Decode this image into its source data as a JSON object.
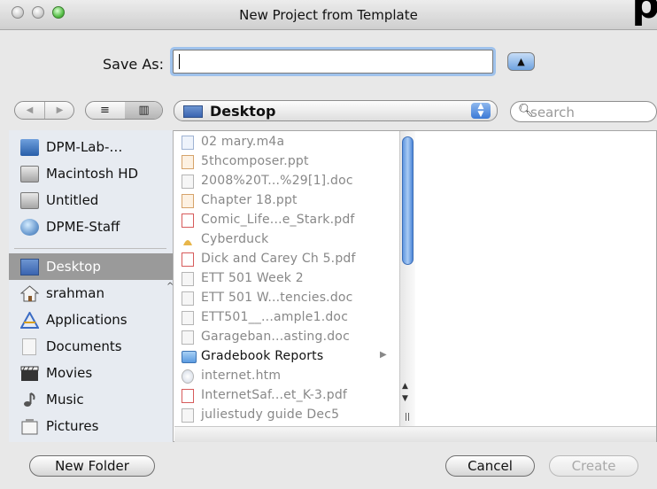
{
  "window": {
    "title": "New Project from Template",
    "corner_mark": "p"
  },
  "save_as": {
    "label": "Save As:",
    "value": ""
  },
  "toolbar": {
    "back_glyph": "◀",
    "forward_glyph": "▶",
    "list_view_glyph": "≡",
    "column_view_glyph": "▥",
    "location": "Desktop",
    "search_placeholder": "search"
  },
  "sidebar": {
    "devices": [
      {
        "label": "DPM-Lab-…",
        "icon": "network-icon"
      },
      {
        "label": "Macintosh HD",
        "icon": "hard-drive-icon"
      },
      {
        "label": "Untitled",
        "icon": "disk-icon"
      },
      {
        "label": "DPME-Staff",
        "icon": "server-icon"
      }
    ],
    "places": [
      {
        "label": "Desktop",
        "icon": "desktop-icon",
        "selected": true
      },
      {
        "label": "srahman",
        "icon": "home-icon"
      },
      {
        "label": "Applications",
        "icon": "applications-icon"
      },
      {
        "label": "Documents",
        "icon": "documents-icon"
      },
      {
        "label": "Movies",
        "icon": "movies-icon"
      },
      {
        "label": "Music",
        "icon": "music-icon"
      },
      {
        "label": "Pictures",
        "icon": "pictures-icon"
      }
    ]
  },
  "files": [
    {
      "label": "02 mary.m4a",
      "icon": "audio-file-icon",
      "enabled": false
    },
    {
      "label": "5thcomposer.ppt",
      "icon": "ppt-file-icon",
      "enabled": false
    },
    {
      "label": "2008%20T...%29[1].doc",
      "icon": "doc-file-icon",
      "enabled": false
    },
    {
      "label": "Chapter 18.ppt",
      "icon": "ppt-file-icon",
      "enabled": false
    },
    {
      "label": "Comic_Life...e_Stark.pdf",
      "icon": "pdf-file-icon",
      "enabled": false
    },
    {
      "label": "Cyberduck",
      "icon": "app-icon",
      "enabled": false
    },
    {
      "label": "Dick and Carey Ch 5.pdf",
      "icon": "pdf-file-icon",
      "enabled": false
    },
    {
      "label": "ETT 501 Week 2",
      "icon": "doc-file-icon",
      "enabled": false
    },
    {
      "label": "ETT 501 W...tencies.doc",
      "icon": "doc-file-icon",
      "enabled": false
    },
    {
      "label": "ETT501__...ample1.doc",
      "icon": "doc-file-icon",
      "enabled": false
    },
    {
      "label": "Garageban...asting.doc",
      "icon": "doc-file-icon",
      "enabled": false
    },
    {
      "label": "Gradebook Reports",
      "icon": "folder-icon",
      "enabled": true,
      "is_folder": true
    },
    {
      "label": "internet.htm",
      "icon": "html-file-icon",
      "enabled": false
    },
    {
      "label": "InternetSaf...et_K-3.pdf",
      "icon": "pdf-file-icon",
      "enabled": false
    },
    {
      "label": "juliestudy guide Dec5",
      "icon": "doc-file-icon",
      "enabled": false
    }
  ],
  "buttons": {
    "new_folder": "New Folder",
    "cancel": "Cancel",
    "create": "Create"
  }
}
